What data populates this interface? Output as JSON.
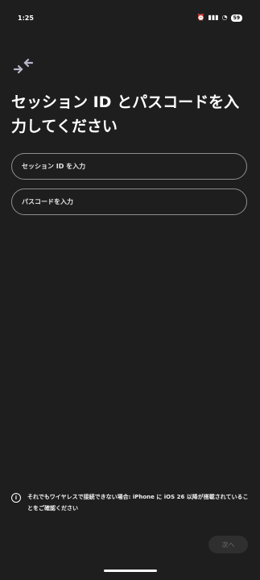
{
  "status_bar": {
    "time": "1:25",
    "icons": [
      "alarm-icon",
      "signal-icon",
      "wifi-icon"
    ],
    "battery": "59"
  },
  "brand_icon": "arrows-inward-icon",
  "title": "セッション ID とパスコードを入力してください",
  "fields": {
    "session_id_placeholder": "セッション ID を入力",
    "passcode_placeholder": "パスコードを入力"
  },
  "notice": {
    "icon": "info-icon",
    "text": "それでもワイヤレスで接続できない場合: iPhone に iOS 26 以降が搭載されていることをご確認ください"
  },
  "next_button": "次へ",
  "colors": {
    "background": "#1e1e1e",
    "field_border": "#8f8f8f",
    "button_disabled_bg": "#2f2f2f",
    "button_disabled_text": "#6d6d6d",
    "accent_icon": "#b9b5ca"
  }
}
